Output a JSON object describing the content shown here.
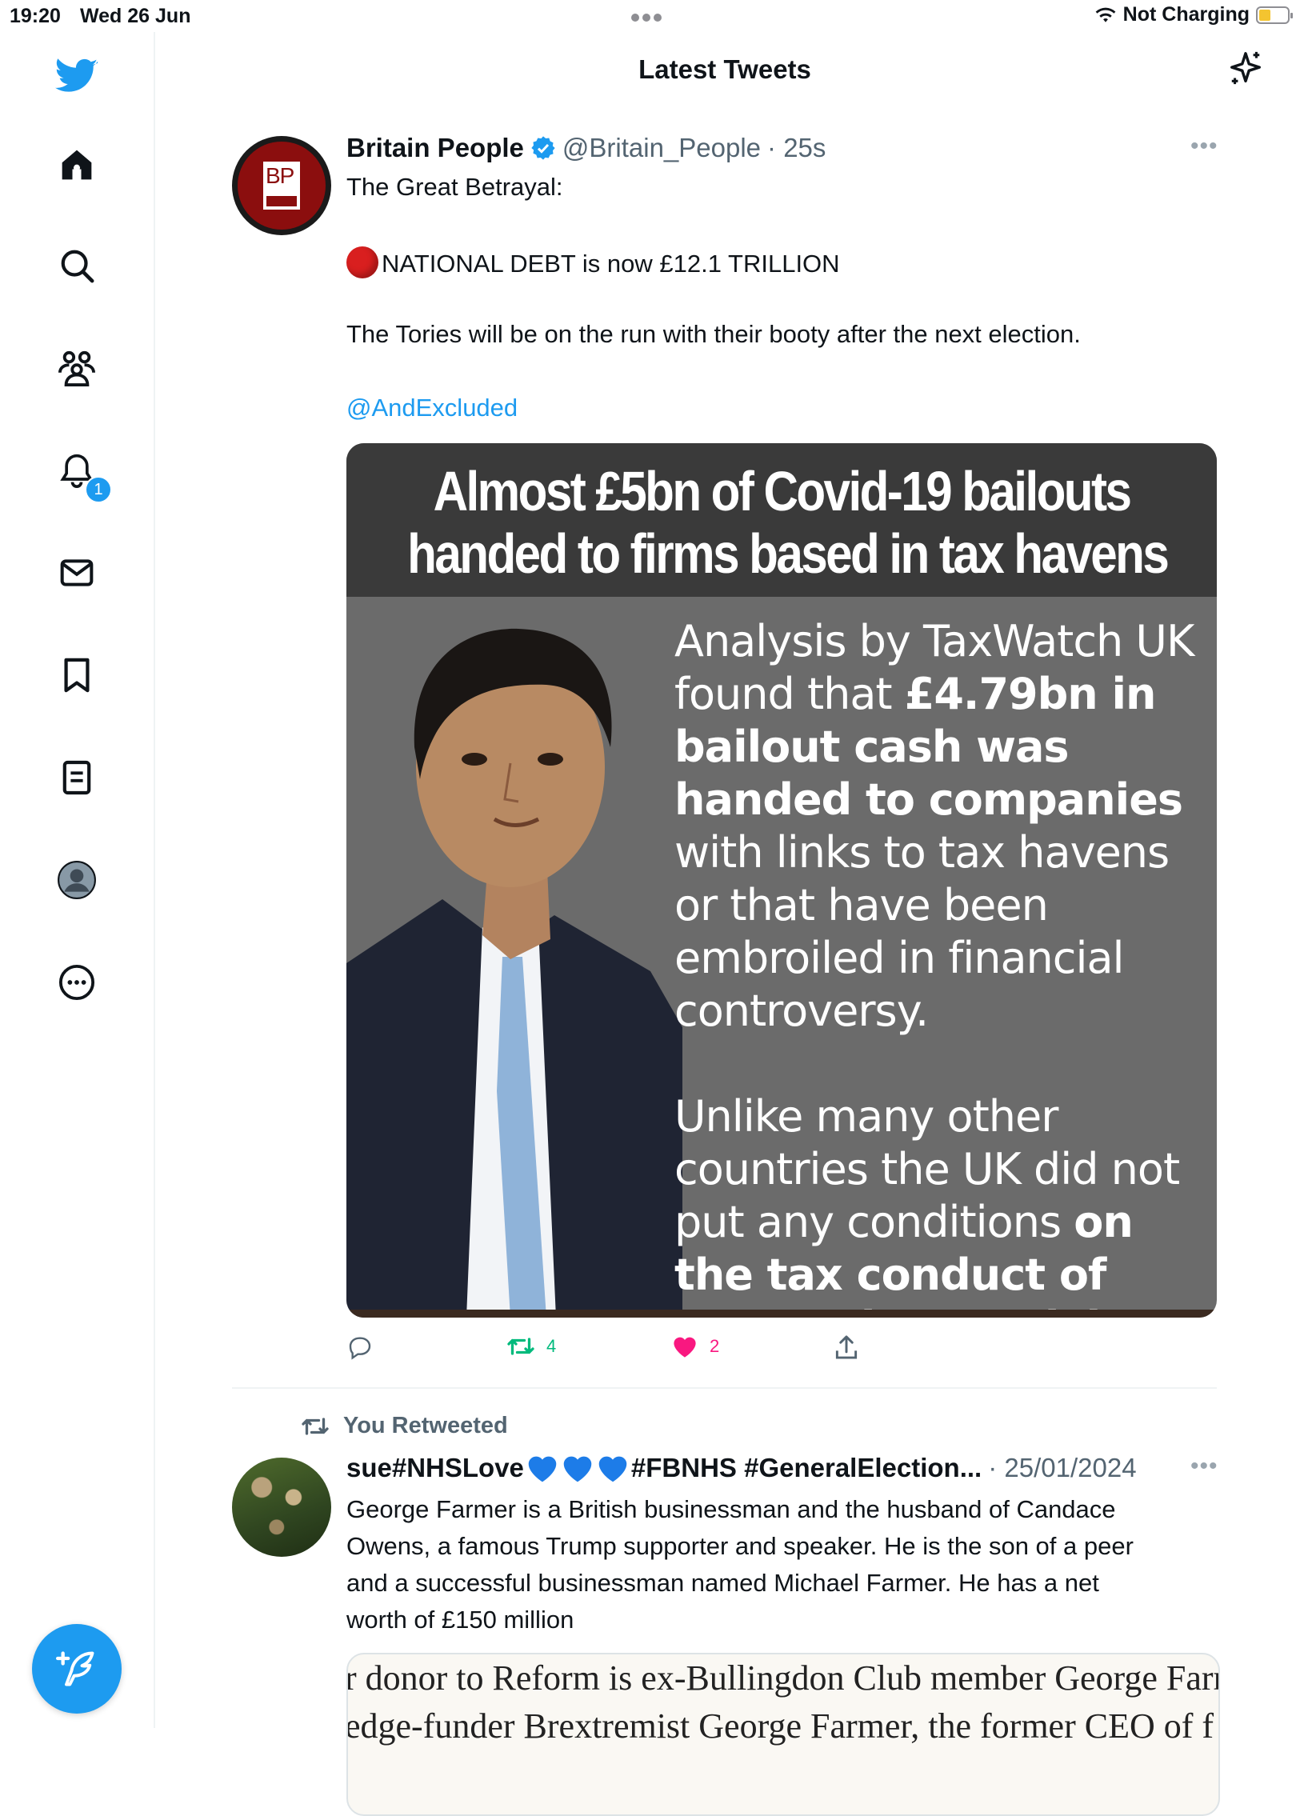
{
  "status_bar": {
    "time": "19:20",
    "date": "Wed 26 Jun",
    "network": "Not Charging"
  },
  "header": {
    "title": "Latest Tweets"
  },
  "nav": {
    "notification_badge": "1"
  },
  "colors": {
    "accent": "#1d9bf0",
    "retweet": "#00ba7c",
    "like": "#f91880"
  },
  "tweet1": {
    "name": "Britain People",
    "handle": "@Britain_People",
    "time": "· 25s",
    "avatar_text": "BP",
    "text_line1": "The Great Betrayal:",
    "text_line2": "NATIONAL DEBT is now £12.1 TRILLION",
    "text_line3": "The Tories will be on the run with their booty after the next election.",
    "mention": "@AndExcluded",
    "image": {
      "headline1": "Almost £5bn of Covid-19 bailouts",
      "headline2": "handed to firms based in tax havens",
      "p1_a": "Analysis by TaxWatch UK found that ",
      "p1_b": "£4.79bn in bailout cash was handed to companies",
      "p1_c": " with links to tax havens or that have been embroiled in financial controversy.",
      "p2_a": "Unlike many other countries the UK did not put any conditions ",
      "p2_b": "on the tax conduct of companies receiving Govt support",
      "p2_c": ".\""
    },
    "retweets": "4",
    "likes": "2"
  },
  "retweet_label": "You Retweeted",
  "tweet2": {
    "name_a": "sue#NHSLove",
    "name_b": "#FBNHS #GeneralElection...",
    "date": "· 25/01/2024",
    "text_line1": "George Farmer is a British businessman and the husband of Candace",
    "text_line2": "Owens, a famous Trump supporter and speaker. He is the son of a peer",
    "text_line3": "and a successful businessman named Michael Farmer. He has a net",
    "text_line4": "worth of £150 million",
    "image_line1": "r donor to Reform is ex-Bullingdon Club member George Farmer",
    "image_line2": "edge-funder Brextremist George Farmer, the former CEO of f"
  }
}
